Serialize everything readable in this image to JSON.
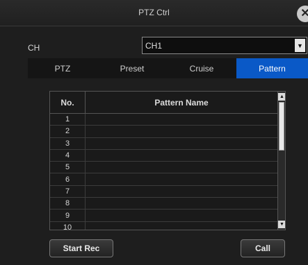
{
  "dialog": {
    "title": "PTZ Ctrl",
    "close_icon": "close-icon"
  },
  "channel": {
    "label": "CH",
    "selected": "CH1",
    "dropdown_icon": "chevron-down-icon"
  },
  "tabs": [
    {
      "label": "PTZ",
      "active": false
    },
    {
      "label": "Preset",
      "active": false
    },
    {
      "label": "Cruise",
      "active": false
    },
    {
      "label": "Pattern",
      "active": true
    }
  ],
  "table": {
    "columns": [
      "No.",
      "Pattern Name"
    ],
    "rows": [
      {
        "no": "1",
        "name": ""
      },
      {
        "no": "2",
        "name": ""
      },
      {
        "no": "3",
        "name": ""
      },
      {
        "no": "4",
        "name": ""
      },
      {
        "no": "5",
        "name": ""
      },
      {
        "no": "6",
        "name": ""
      },
      {
        "no": "7",
        "name": ""
      },
      {
        "no": "8",
        "name": ""
      },
      {
        "no": "9",
        "name": ""
      },
      {
        "no": "10",
        "name": ""
      }
    ]
  },
  "buttons": {
    "start_rec": "Start Rec",
    "call": "Call"
  },
  "colors": {
    "active_tab": "#0a59c7",
    "background": "#1e1e1e"
  }
}
